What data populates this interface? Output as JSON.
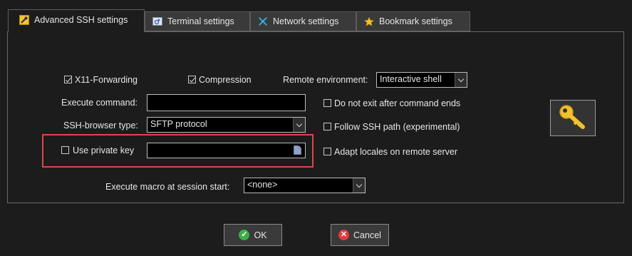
{
  "tabs": [
    {
      "label": "Advanced SSH settings",
      "icon": "wrench-icon",
      "active": true
    },
    {
      "label": "Terminal settings",
      "icon": "terminal-icon",
      "active": false
    },
    {
      "label": "Network settings",
      "icon": "network-icon",
      "active": false
    },
    {
      "label": "Bookmark settings",
      "icon": "star-icon",
      "active": false
    }
  ],
  "options": {
    "x11_forwarding": {
      "label": "X11-Forwarding",
      "checked": true
    },
    "compression": {
      "label": "Compression",
      "checked": true
    },
    "remote_env": {
      "label": "Remote environment:",
      "value": "Interactive shell"
    },
    "execute_command": {
      "label": "Execute command:",
      "value": ""
    },
    "do_not_exit": {
      "label": "Do not exit after command ends",
      "checked": false
    },
    "ssh_browser": {
      "label": "SSH-browser type:",
      "value": "SFTP protocol"
    },
    "follow_path": {
      "label": "Follow SSH path (experimental)",
      "checked": false
    },
    "private_key": {
      "label": "Use private key",
      "checked": false,
      "value": ""
    },
    "adapt_locales": {
      "label": "Adapt locales on remote server",
      "checked": false
    },
    "macro": {
      "label": "Execute macro at session start:",
      "value": "<none>"
    }
  },
  "footer": {
    "ok_label": "OK",
    "cancel_label": "Cancel"
  },
  "colors": {
    "highlight": "#e0444a",
    "ok_icon": "#3fae49",
    "cancel_icon": "#e23b3b",
    "key_icon": "#f2c12e"
  }
}
